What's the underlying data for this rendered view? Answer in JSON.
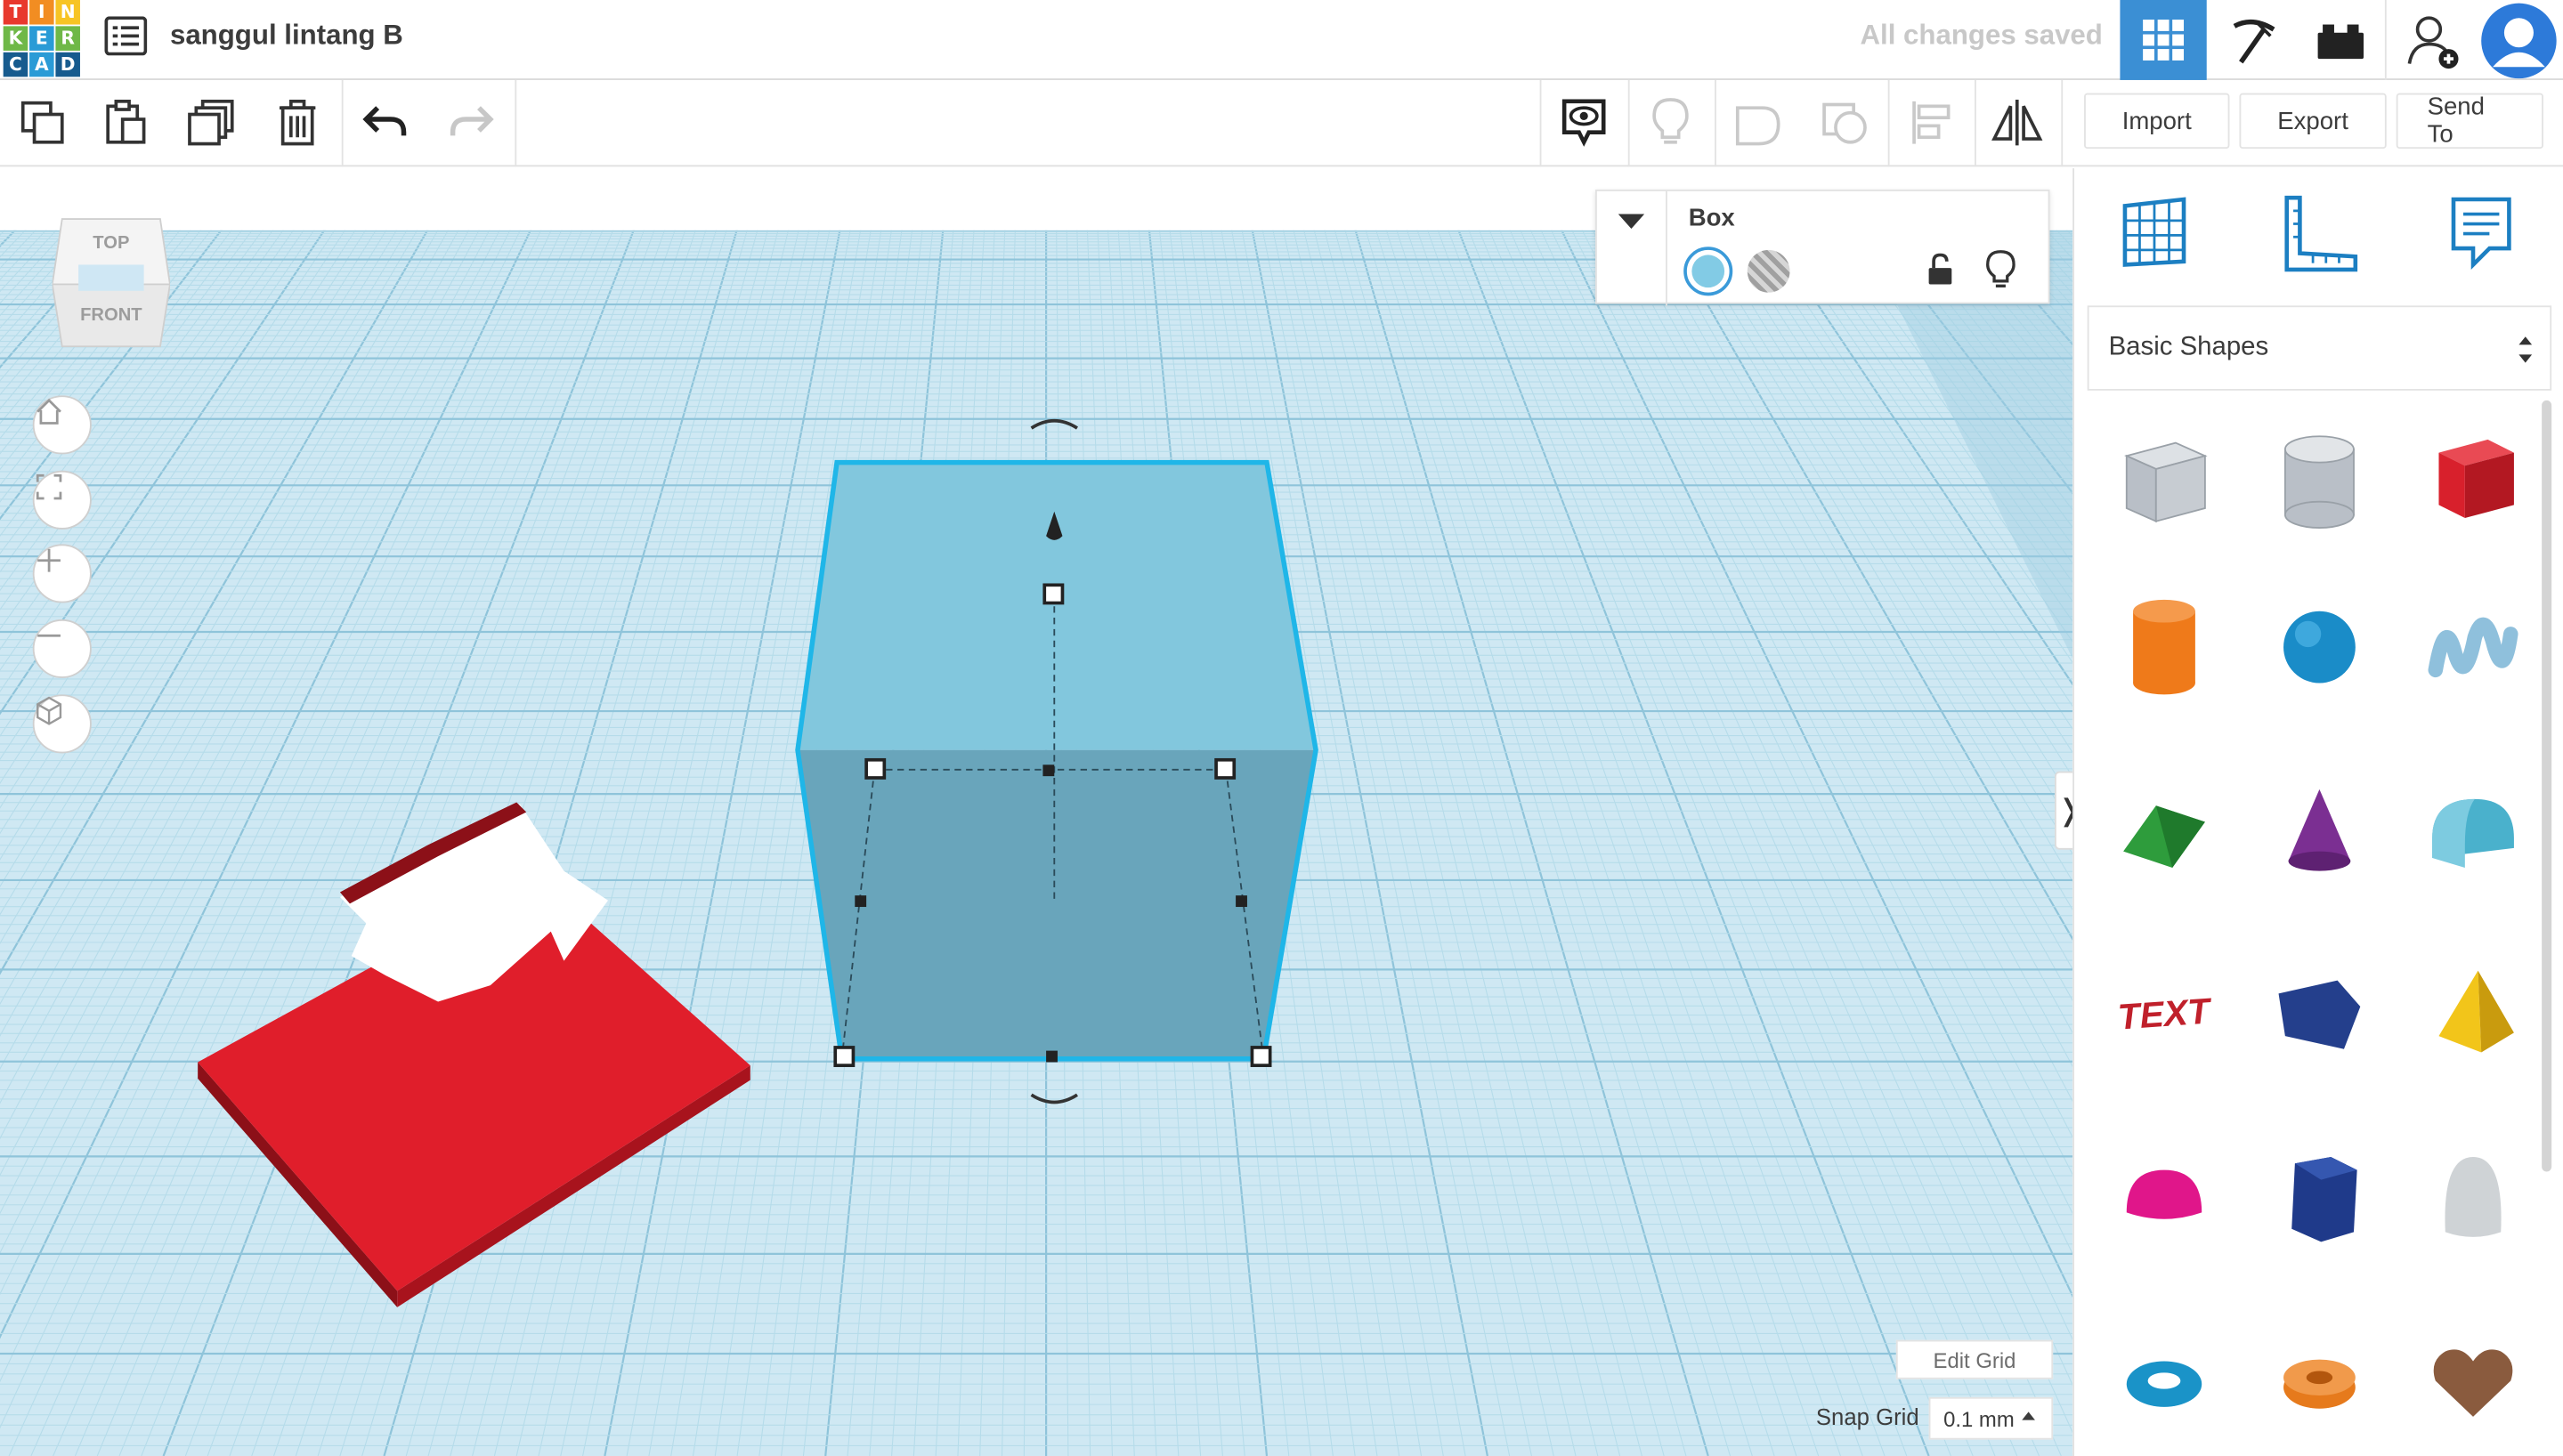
{
  "app": {
    "logo_letters": [
      "T",
      "I",
      "N",
      "K",
      "E",
      "R",
      "C",
      "A",
      "D"
    ],
    "document_title": "sanggul lintang B",
    "save_status": "All changes saved"
  },
  "header": {
    "views": [
      {
        "icon": "3d-design-grid-icon",
        "active": true
      },
      {
        "icon": "pickaxe-icon",
        "active": false
      },
      {
        "icon": "bricks-icon",
        "active": false
      }
    ],
    "user_icons": [
      "add-user-icon",
      "user-avatar-icon"
    ]
  },
  "toolbar": {
    "left_tools": [
      "copy-icon",
      "paste-icon",
      "duplicate-icon",
      "delete-icon",
      "undo-icon",
      "redo-icon"
    ],
    "right_tools": [
      "show-hide-icon",
      "bulb-icon",
      "group-icon",
      "ungroup-icon",
      "align-icon",
      "mirror-icon"
    ],
    "import_label": "Import",
    "export_label": "Export",
    "send_to_label": "Send To"
  },
  "viewcube": {
    "top_label": "TOP",
    "front_label": "FRONT"
  },
  "nav_controls": [
    "home-view-icon",
    "fit-all-icon",
    "zoom-in-icon",
    "zoom-out-icon",
    "perspective-icon"
  ],
  "inspector": {
    "shape_name": "Box",
    "solid_color": "#82cbe5",
    "mode": "solid"
  },
  "grid_controls": {
    "edit_grid_label": "Edit Grid",
    "snap_grid_label": "Snap Grid",
    "snap_grid_value": "0.1 mm"
  },
  "panel_toggle_glyph": "❭",
  "right_panel": {
    "tools": [
      "workplane-icon",
      "ruler-icon",
      "notes-icon"
    ],
    "shape_library_selected": "Basic Shapes",
    "shapes": [
      {
        "name": "box-hole",
        "color": "#b9bfc7"
      },
      {
        "name": "cylinder-hole",
        "color": "#b9bfc7"
      },
      {
        "name": "box",
        "color": "#d8202c"
      },
      {
        "name": "cylinder",
        "color": "#ef7a1a"
      },
      {
        "name": "sphere",
        "color": "#1a8cc8"
      },
      {
        "name": "scribble",
        "color": "#8fc0dc"
      },
      {
        "name": "roof",
        "color": "#2e9c3c"
      },
      {
        "name": "cone",
        "color": "#7b2f92"
      },
      {
        "name": "round-roof",
        "color": "#4ab1cc"
      },
      {
        "name": "text",
        "color": "#c0202b"
      },
      {
        "name": "wedge",
        "color": "#243f8c"
      },
      {
        "name": "pyramid",
        "color": "#f2c51a"
      },
      {
        "name": "half-sphere",
        "color": "#e0168a"
      },
      {
        "name": "polygon",
        "color": "#1f3a8a"
      },
      {
        "name": "paraboloid",
        "color": "#cfd3d6"
      },
      {
        "name": "torus",
        "color": "#1a93c8"
      },
      {
        "name": "tube",
        "color": "#e67a1c"
      },
      {
        "name": "heart",
        "color": "#8a5b3e"
      }
    ]
  },
  "scene": {
    "objects": [
      {
        "name": "red-star-plate",
        "color": "#e01e2b"
      },
      {
        "name": "selected-box",
        "color": "#82c7dd"
      }
    ]
  }
}
